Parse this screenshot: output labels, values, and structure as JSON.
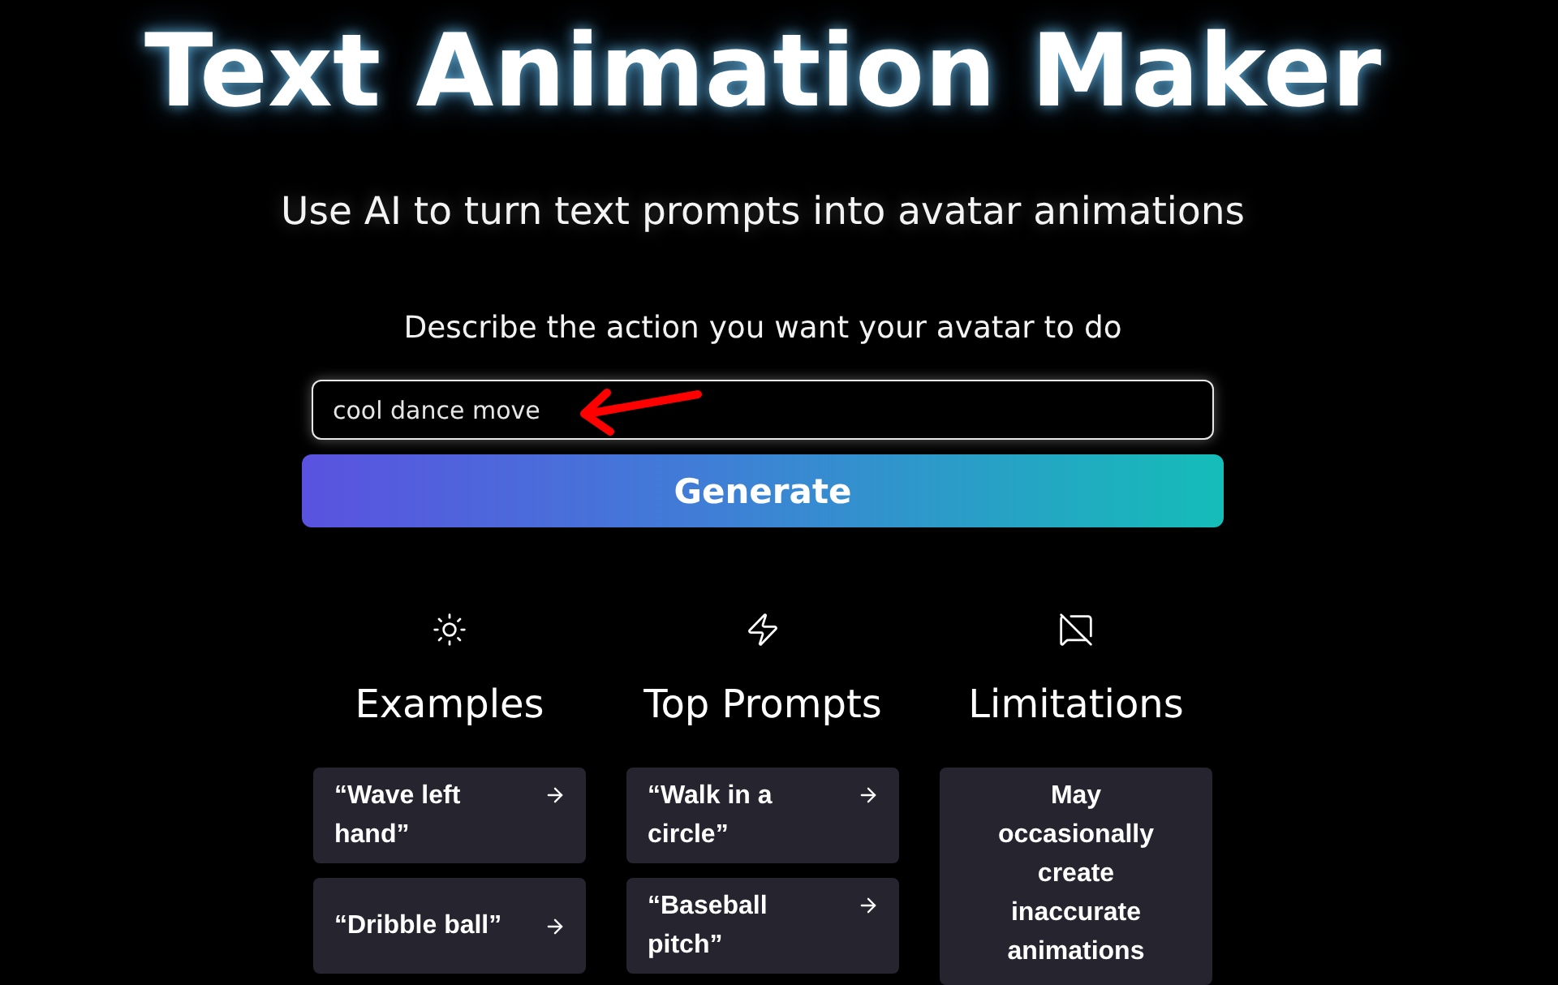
{
  "title": "Text Animation Maker",
  "subtitle": "Use AI to turn text prompts into avatar animations",
  "prompt": {
    "label": "Describe the action you want your avatar to do",
    "value": "cool dance move"
  },
  "generate_button": "Generate",
  "columns": [
    {
      "heading": "Examples",
      "items": [
        {
          "kind": "prompt",
          "text": "“Wave left hand”"
        },
        {
          "kind": "prompt",
          "text": "“Dribble ball”"
        }
      ]
    },
    {
      "heading": "Top Prompts",
      "items": [
        {
          "kind": "prompt",
          "text": "“Walk in a circle”"
        },
        {
          "kind": "prompt",
          "text": "“Baseball pitch”"
        }
      ]
    },
    {
      "heading": "Limitations",
      "items": [
        {
          "kind": "note",
          "text": "May occasionally create inaccurate animations"
        }
      ]
    }
  ]
}
